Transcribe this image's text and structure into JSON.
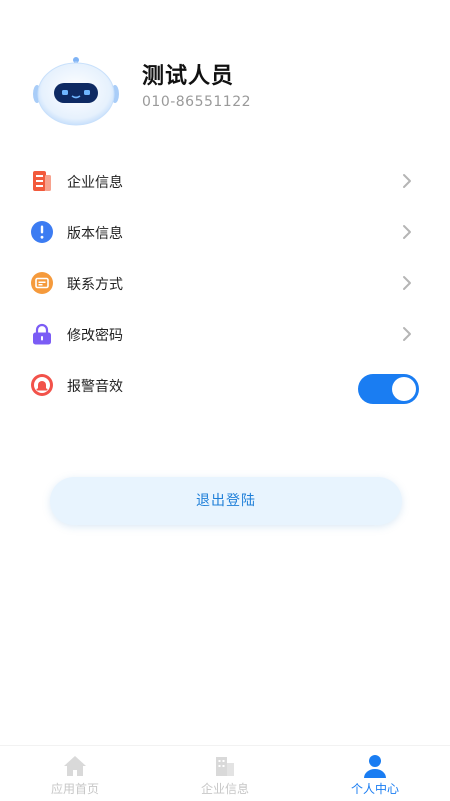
{
  "profile": {
    "name": "测试人员",
    "phone": "010-86551122"
  },
  "menu": {
    "items": [
      {
        "label": "企业信息"
      },
      {
        "label": "版本信息"
      },
      {
        "label": "联系方式"
      },
      {
        "label": "修改密码"
      },
      {
        "label": "报警音效"
      }
    ],
    "alarm_sound_enabled": true
  },
  "logout_label": "退出登陆",
  "tabbar": {
    "tabs": [
      {
        "label": "应用首页"
      },
      {
        "label": "企业信息"
      },
      {
        "label": "个人中心"
      }
    ],
    "active_index": 2
  },
  "colors": {
    "accent": "#1a7df2",
    "icon_company": "#f25a3c",
    "icon_version": "#3c7cf2",
    "icon_contact": "#f59a3c",
    "icon_password": "#7b5cf5",
    "icon_alarm": "#f2524a"
  },
  "icons": {
    "avatar": "robot-avatar-icon",
    "company_info": "document-icon",
    "version_info": "exclamation-icon",
    "contact": "id-card-icon",
    "change_password": "lock-icon",
    "alarm_sound": "alarm-bell-icon",
    "menu_arrow": "chevron-right-icon",
    "tab_home": "home-icon",
    "tab_company": "building-icon",
    "tab_profile": "person-icon"
  }
}
